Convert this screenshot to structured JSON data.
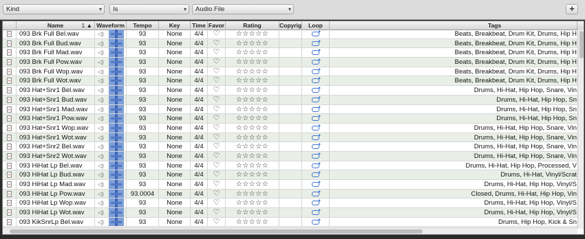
{
  "filters": {
    "field": "Kind",
    "operator": "Is",
    "value": "Audio File",
    "add_label": "+"
  },
  "columns": {
    "name": "Name",
    "sort": "1",
    "waveform": "Waveform",
    "tempo": "Tempo",
    "key": "Key",
    "time": "Time",
    "favorite": "Favor",
    "rating": "Rating",
    "copyright": "Copyrig",
    "loop": "Loop",
    "tags": "Tags"
  },
  "rows": [
    {
      "name": "093 Brk Full Bel.wav",
      "tempo": "93",
      "key": "None",
      "time": "4/4",
      "fav": "♡",
      "rating": "☆☆☆☆☆",
      "tags": "Beats, Breakbeat, Drum Kit, Drums, Hip H"
    },
    {
      "name": "093 Brk Full Bud.wav",
      "tempo": "93",
      "key": "None",
      "time": "4/4",
      "fav": "♡",
      "rating": "☆☆☆☆☆",
      "tags": "Beats, Breakbeat, Drum Kit, Drums, Hip H"
    },
    {
      "name": "093 Brk Full Mad.wav",
      "tempo": "93",
      "key": "None",
      "time": "4/4",
      "fav": "♡",
      "rating": "☆☆☆☆☆",
      "tags": "Beats, Breakbeat, Drum Kit, Drums, Hip H"
    },
    {
      "name": "093 Brk Full Pow.wav",
      "tempo": "93",
      "key": "None",
      "time": "4/4",
      "fav": "♡",
      "rating": "☆☆☆☆☆",
      "tags": "Beats, Breakbeat, Drum Kit, Drums, Hip H"
    },
    {
      "name": "093 Brk Full Wop.wav",
      "tempo": "93",
      "key": "None",
      "time": "4/4",
      "fav": "♡",
      "rating": "☆☆☆☆☆",
      "tags": "Beats, Breakbeat, Drum Kit, Drums, Hip H"
    },
    {
      "name": "093 Brk Full Wot.wav",
      "tempo": "93",
      "key": "None",
      "time": "4/4",
      "fav": "♡",
      "rating": "☆☆☆☆☆",
      "tags": "Beats, Breakbeat, Drum Kit, Drums, Hip H"
    },
    {
      "name": "093 Hat+Snr1 Bel.wav",
      "tempo": "93",
      "key": "None",
      "time": "4/4",
      "fav": "♡",
      "rating": "☆☆☆☆☆",
      "tags": "Drums, Hi-Hat, Hip Hop, Snare, Vin"
    },
    {
      "name": "093 Hat+Snr1 Bud.wav",
      "tempo": "93",
      "key": "None",
      "time": "4/4",
      "fav": "♡",
      "rating": "☆☆☆☆☆",
      "tags": "Drums, Hi-Hat, Hip Hop, Sn"
    },
    {
      "name": "093 Hat+Snr1 Mad.wav",
      "tempo": "93",
      "key": "None",
      "time": "4/4",
      "fav": "♡",
      "rating": "☆☆☆☆☆",
      "tags": "Drums, Hi-Hat, Hip Hop, Sn"
    },
    {
      "name": "093 Hat+Snr1 Pow.wav",
      "tempo": "93",
      "key": "None",
      "time": "4/4",
      "fav": "♡",
      "rating": "☆☆☆☆☆",
      "tags": "Drums, Hi-Hat, Hip Hop, Sn"
    },
    {
      "name": "093 Hat+Snr1 Wop.wav",
      "tempo": "93",
      "key": "None",
      "time": "4/4",
      "fav": "♡",
      "rating": "☆☆☆☆☆",
      "tags": "Drums, Hi-Hat, Hip Hop, Snare, Vin"
    },
    {
      "name": "093 Hat+Snr1 Wot.wav",
      "tempo": "93",
      "key": "None",
      "time": "4/4",
      "fav": "♡",
      "rating": "☆☆☆☆☆",
      "tags": "Drums, Hi-Hat, Hip Hop, Snare, Vin"
    },
    {
      "name": "093 Hat+Snr2 Bel.wav",
      "tempo": "93",
      "key": "None",
      "time": "4/4",
      "fav": "♡",
      "rating": "☆☆☆☆☆",
      "tags": "Drums, Hi-Hat, Hip Hop, Snare, Vin"
    },
    {
      "name": "093 Hat+Snr2 Wot.wav",
      "tempo": "93",
      "key": "None",
      "time": "4/4",
      "fav": "♡",
      "rating": "☆☆☆☆☆",
      "tags": "Drums, Hi-Hat, Hip Hop, Snare, Vin"
    },
    {
      "name": "093 HiHat Lp Bel.wav",
      "tempo": "93",
      "key": "None",
      "time": "4/4",
      "fav": "♡",
      "rating": "☆☆☆☆☆",
      "tags": "Drums, Hi-Hat, Hip Hop, Processed, V"
    },
    {
      "name": "093 HiHat Lp Bud.wav",
      "tempo": "93",
      "key": "None",
      "time": "4/4",
      "fav": "♡",
      "rating": "☆☆☆☆☆",
      "tags": "Drums, Hi-Hat, Vinyl/Scrat"
    },
    {
      "name": "093 HiHat Lp Mad.wav",
      "tempo": "93",
      "key": "None",
      "time": "4/4",
      "fav": "♡",
      "rating": "☆☆☆☆☆",
      "tags": "Drums, Hi-Hat, Hip Hop, Vinyl/S"
    },
    {
      "name": "093 HiHat Lp Pow.wav",
      "tempo": "93.0004",
      "key": "None",
      "time": "4/4",
      "fav": "♡",
      "rating": "☆☆☆☆☆",
      "tags": "Closed, Drums, Hi-Hat, Hip Hop, Vin"
    },
    {
      "name": "093 HiHat Lp Wop.wav",
      "tempo": "93",
      "key": "None",
      "time": "4/4",
      "fav": "♡",
      "rating": "☆☆☆☆☆",
      "tags": "Drums, Hi-Hat, Hip Hop, Vinyl/S"
    },
    {
      "name": "093 HiHat Lp Wot.wav",
      "tempo": "93",
      "key": "None",
      "time": "4/4",
      "fav": "♡",
      "rating": "☆☆☆☆☆",
      "tags": "Drums, Hi-Hat, Hip Hop, Vinyl/S"
    },
    {
      "name": "093 KikSnrLp Bel.wav",
      "tempo": "93",
      "key": "None",
      "time": "4/4",
      "fav": "♡",
      "rating": "☆☆☆☆☆",
      "tags": "Drums, Hip Hop, Kick & Sn"
    }
  ]
}
